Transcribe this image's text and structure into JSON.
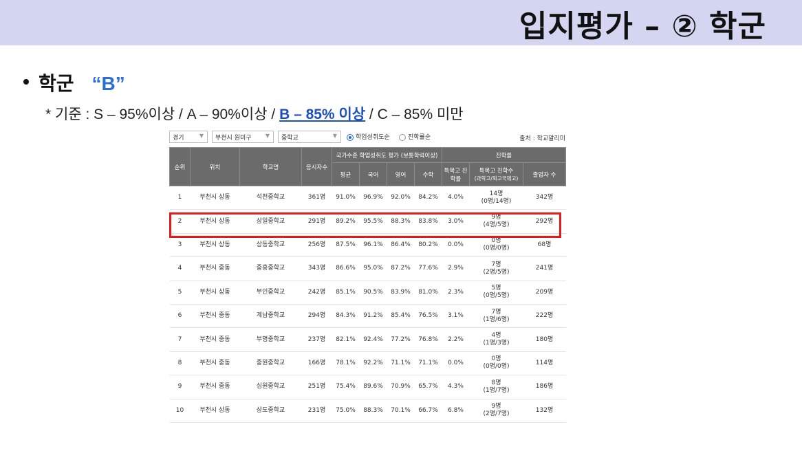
{
  "header": {
    "title": "입지평가 – ② 학군"
  },
  "bullet": {
    "label": "학군",
    "grade": "“B”"
  },
  "criteria": {
    "prefix": "* 기준 : S – 95%이상 / A – 90%이상 / ",
    "highlight": "B – 85% 이상",
    "suffix": " / C – 85% 미만"
  },
  "filters": {
    "region": "경기",
    "city": "부천시 원미구",
    "level": "중학교",
    "radio_1": "학업성취도순",
    "radio_2": "진학률순",
    "source": "출처 : 학교알리미"
  },
  "table": {
    "headers": {
      "rank": "순위",
      "location": "위치",
      "school": "학교명",
      "examinees": "응시자수",
      "group_achievement": "국가수준 학업성취도 평가 (보통학력이상)",
      "group_advance": "진학률",
      "avg": "평균",
      "korean": "국어",
      "english": "영어",
      "math": "수학",
      "special_rate": "특목고 진학률",
      "special_count": "특목고 진학수",
      "special_count_sub": "(과학고/외고국제고)",
      "graduates": "졸업자 수"
    },
    "rows": [
      {
        "rank": "1",
        "location": "부천시 상동",
        "school": "석천중학교",
        "examinees": "361명",
        "avg": "91.0%",
        "korean": "96.9%",
        "english": "92.0%",
        "math": "84.2%",
        "special_rate": "4.0%",
        "special_count": "14명",
        "special_detail": "(0명/14명)",
        "graduates": "342명"
      },
      {
        "rank": "2",
        "location": "부천시 상동",
        "school": "상일중학교",
        "examinees": "291명",
        "avg": "89.2%",
        "korean": "95.5%",
        "english": "88.3%",
        "math": "83.8%",
        "special_rate": "3.0%",
        "special_count": "9명",
        "special_detail": "(4명/5명)",
        "graduates": "292명"
      },
      {
        "rank": "3",
        "location": "부천시 상동",
        "school": "상동중학교",
        "examinees": "256명",
        "avg": "87.5%",
        "korean": "96.1%",
        "english": "86.4%",
        "math": "80.2%",
        "special_rate": "0.0%",
        "special_count": "0명",
        "special_detail": "(0명/0명)",
        "graduates": "68명"
      },
      {
        "rank": "4",
        "location": "부천시 중동",
        "school": "중흥중학교",
        "examinees": "343명",
        "avg": "86.6%",
        "korean": "95.0%",
        "english": "87.2%",
        "math": "77.6%",
        "special_rate": "2.9%",
        "special_count": "7명",
        "special_detail": "(2명/5명)",
        "graduates": "241명"
      },
      {
        "rank": "5",
        "location": "부천시 상동",
        "school": "부인중학교",
        "examinees": "242명",
        "avg": "85.1%",
        "korean": "90.5%",
        "english": "83.9%",
        "math": "81.0%",
        "special_rate": "2.3%",
        "special_count": "5명",
        "special_detail": "(0명/5명)",
        "graduates": "209명"
      },
      {
        "rank": "6",
        "location": "부천시 중동",
        "school": "계남중학교",
        "examinees": "294명",
        "avg": "84.3%",
        "korean": "91.2%",
        "english": "85.4%",
        "math": "76.5%",
        "special_rate": "3.1%",
        "special_count": "7명",
        "special_detail": "(1명/6명)",
        "graduates": "222명"
      },
      {
        "rank": "7",
        "location": "부천시 중동",
        "school": "부명중학교",
        "examinees": "237명",
        "avg": "82.1%",
        "korean": "92.4%",
        "english": "77.2%",
        "math": "76.8%",
        "special_rate": "2.2%",
        "special_count": "4명",
        "special_detail": "(1명/3명)",
        "graduates": "180명"
      },
      {
        "rank": "8",
        "location": "부천시 중동",
        "school": "중원중학교",
        "examinees": "166명",
        "avg": "78.1%",
        "korean": "92.2%",
        "english": "71.1%",
        "math": "71.1%",
        "special_rate": "0.0%",
        "special_count": "0명",
        "special_detail": "(0명/0명)",
        "graduates": "114명"
      },
      {
        "rank": "9",
        "location": "부천시 중동",
        "school": "심원중학교",
        "examinees": "251명",
        "avg": "75.4%",
        "korean": "89.6%",
        "english": "70.9%",
        "math": "65.7%",
        "special_rate": "4.3%",
        "special_count": "8명",
        "special_detail": "(1명/7명)",
        "graduates": "186명"
      },
      {
        "rank": "10",
        "location": "부천시 상동",
        "school": "상도중학교",
        "examinees": "231명",
        "avg": "75.0%",
        "korean": "88.3%",
        "english": "70.1%",
        "math": "66.7%",
        "special_rate": "6.8%",
        "special_count": "9명",
        "special_detail": "(2명/7명)",
        "graduates": "132명"
      }
    ]
  },
  "colors": {
    "banner": "#d4d5f0",
    "highlight": "#1d4fbf",
    "grade": "#2b6fd6",
    "redbox": "#e51a1a",
    "header": "#6b6b6b"
  }
}
